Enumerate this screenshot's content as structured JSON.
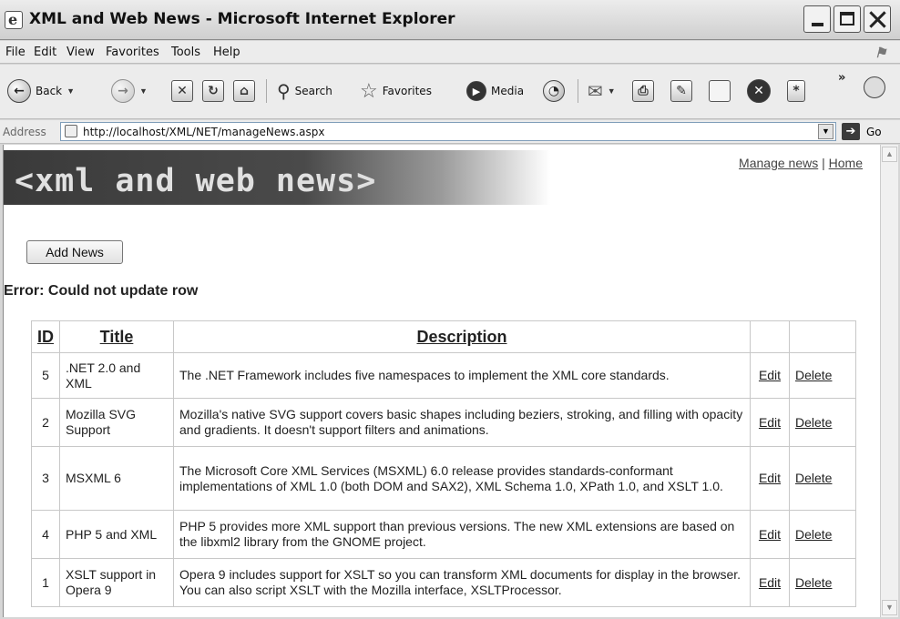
{
  "window": {
    "title": "XML and Web News - Microsoft Internet Explorer"
  },
  "menu": [
    "File",
    "Edit",
    "View",
    "Favorites",
    "Tools",
    "Help"
  ],
  "toolbar": {
    "back": "Back",
    "search": "Search",
    "favorites": "Favorites",
    "media": "Media",
    "more": "»"
  },
  "address": {
    "label": "Address",
    "url": "http://localhost/XML/NET/manageNews.aspx",
    "go": "Go"
  },
  "page": {
    "banner": "<xml and web news>",
    "links": {
      "manage": "Manage news",
      "separator": "|",
      "home": "Home"
    },
    "add_button": "Add News",
    "error": "Error: Could not update row",
    "table": {
      "headers": {
        "id": "ID",
        "title": "Title",
        "description": "Description"
      },
      "edit_label": "Edit",
      "delete_label": "Delete",
      "rows": [
        {
          "id": "5",
          "title": ".NET 2.0 and XML",
          "description": "The .NET Framework includes five namespaces to implement the XML core standards."
        },
        {
          "id": "2",
          "title": "Mozilla SVG Support",
          "description": "Mozilla's native SVG support covers basic shapes including beziers, stroking, and filling with opacity and gradients. It doesn't support filters and animations."
        },
        {
          "id": "3",
          "title": "MSXML 6",
          "description": "The Microsoft Core XML Services (MSXML) 6.0 release provides standards-conformant implementations of XML 1.0 (both DOM and SAX2), XML Schema 1.0, XPath 1.0, and XSLT 1.0."
        },
        {
          "id": "4",
          "title": "PHP 5 and XML",
          "description": "PHP 5 provides more XML support than previous versions. The new XML extensions are based on the libxml2 library from the GNOME project."
        },
        {
          "id": "1",
          "title": "XSLT support in Opera 9",
          "description": "Opera 9 includes support for XSLT so you can transform XML documents for display in the browser. You can also script XSLT with the Mozilla interface, XSLTProcessor."
        }
      ]
    }
  }
}
